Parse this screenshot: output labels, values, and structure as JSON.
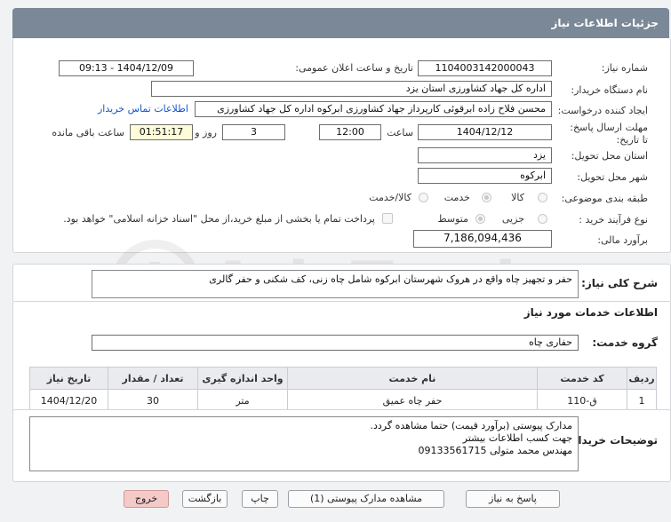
{
  "header": {
    "title": "جزئیات اطلاعات نیاز"
  },
  "labels": {
    "need_number": "شماره نیاز:",
    "announce_datetime": "تاریخ و ساعت اعلان عمومی:",
    "buyer_org": "نام دستگاه خریدار:",
    "requester": "ایجاد کننده درخواست:",
    "deadline": "مهلت ارسال پاسخ: تا تاریخ:",
    "time_word": "ساعت",
    "days_word": "روز و",
    "remaining": "ساعت باقی مانده",
    "province": "استان محل تحویل:",
    "city": "شهر محل تحویل:",
    "category": "طبقه بندی موضوعی:",
    "process": "نوع فرآیند خرید :",
    "estimate": "برآورد مالی:",
    "general_desc": "شرح کلی نیاز:",
    "services_info": "اطلاعات خدمات مورد نیاز",
    "service_group": "گروه خدمت:",
    "buyer_notes": "توضیحات خریدار:"
  },
  "values": {
    "need_number": "1104003142000043",
    "announce_datetime": "1404/12/09 - 09:13",
    "buyer_org": "اداره کل جهاد کشاورزی استان یزد",
    "requester": "محسن فلاح زاده ابرقوئی کارپرداز جهاد کشاورزی ابرکوه اداره کل جهاد کشاورزی",
    "contact_link": "اطلاعات تماس خریدار",
    "deadline_date": "1404/12/12",
    "deadline_time": "12:00",
    "days": "3",
    "remaining_time": "01:51:17",
    "province": "یزد",
    "city": "ابرکوه",
    "estimate": "7,186,094,436",
    "general_desc": "حفر و تجهیز چاه واقع در هروک شهرستان ابرکوه شامل چاه زنی، کف شکنی و حفر گالری",
    "service_group": "حفاری چاه"
  },
  "category_options": [
    "کالا",
    "خدمت",
    "کالا/خدمت"
  ],
  "category_selected": "خدمت",
  "process_options": [
    "جزیی",
    "متوسط"
  ],
  "process_selected": "متوسط",
  "payment_note": "پرداخت تمام یا بخشی از مبلغ خرید،از محل \"اسناد خزانه اسلامی\" خواهد بود.",
  "table": {
    "headers": [
      "ردیف",
      "کد خدمت",
      "نام خدمت",
      "واحد اندازه گیری",
      "تعداد / مقدار",
      "تاریخ نیاز"
    ],
    "rows": [
      [
        "1",
        "ق-110",
        "حفر چاه عمیق",
        "متر",
        "30",
        "1404/12/20"
      ]
    ]
  },
  "notes_lines": [
    "مدارک پیوستی (برآورد قیمت) حتما مشاهده گردد.",
    "جهت کسب اطلاعات بیشتر",
    "مهندس محمد متولی 09133561715"
  ],
  "buttons": {
    "reply": "پاسخ به نیاز",
    "attachments": "مشاهده مدارک پیوستی (1)",
    "print": "چاپ",
    "back": "بازگشت",
    "exit": "خروج"
  },
  "watermark_text": "AriaTender.neT"
}
